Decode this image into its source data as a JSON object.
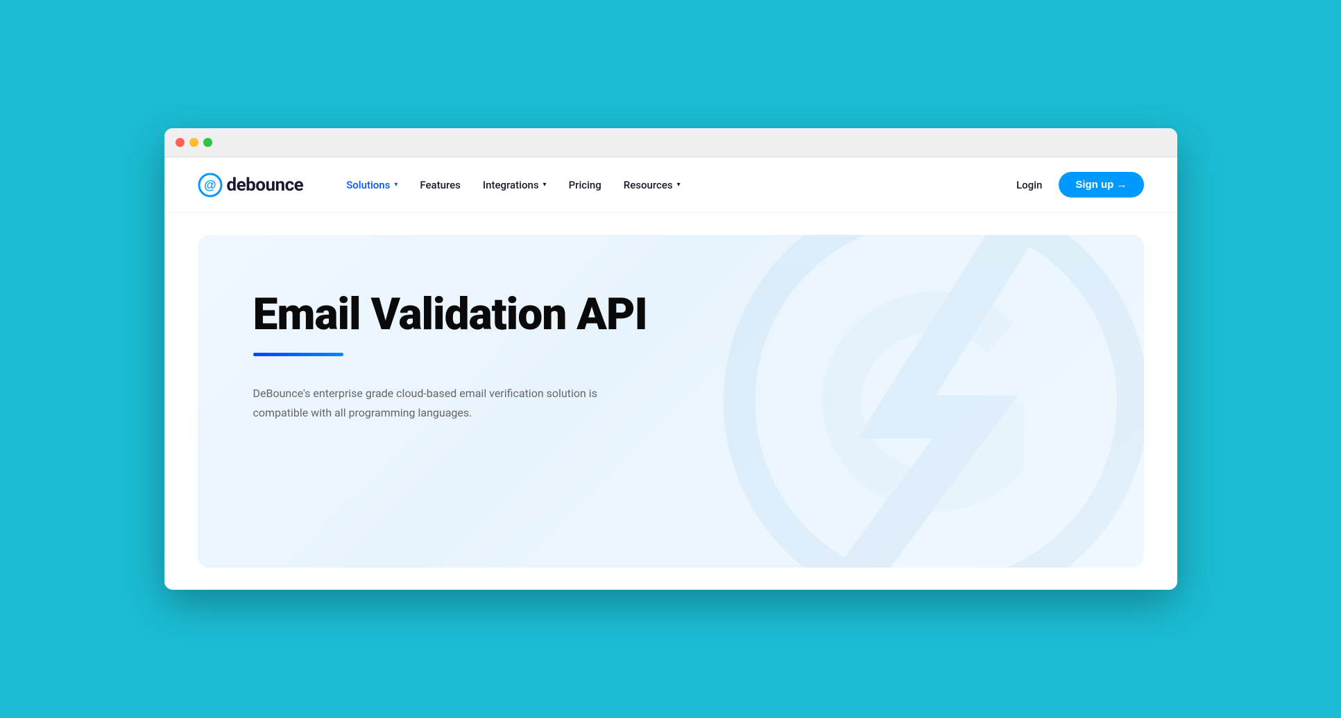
{
  "browser": {
    "dots": [
      "red",
      "yellow",
      "green"
    ]
  },
  "navbar": {
    "logo_text": "debounce",
    "nav_items": [
      {
        "label": "Solutions",
        "has_dropdown": true,
        "active": true
      },
      {
        "label": "Features",
        "has_dropdown": false,
        "active": false
      },
      {
        "label": "Integrations",
        "has_dropdown": true,
        "active": false
      },
      {
        "label": "Pricing",
        "has_dropdown": false,
        "active": false
      },
      {
        "label": "Resources",
        "has_dropdown": true,
        "active": false
      }
    ],
    "login_label": "Login",
    "signup_label": "Sign up →"
  },
  "hero": {
    "title": "Email Validation API",
    "description": "DeBounce's enterprise grade cloud-based email verification solution is compatible with all programming languages."
  }
}
